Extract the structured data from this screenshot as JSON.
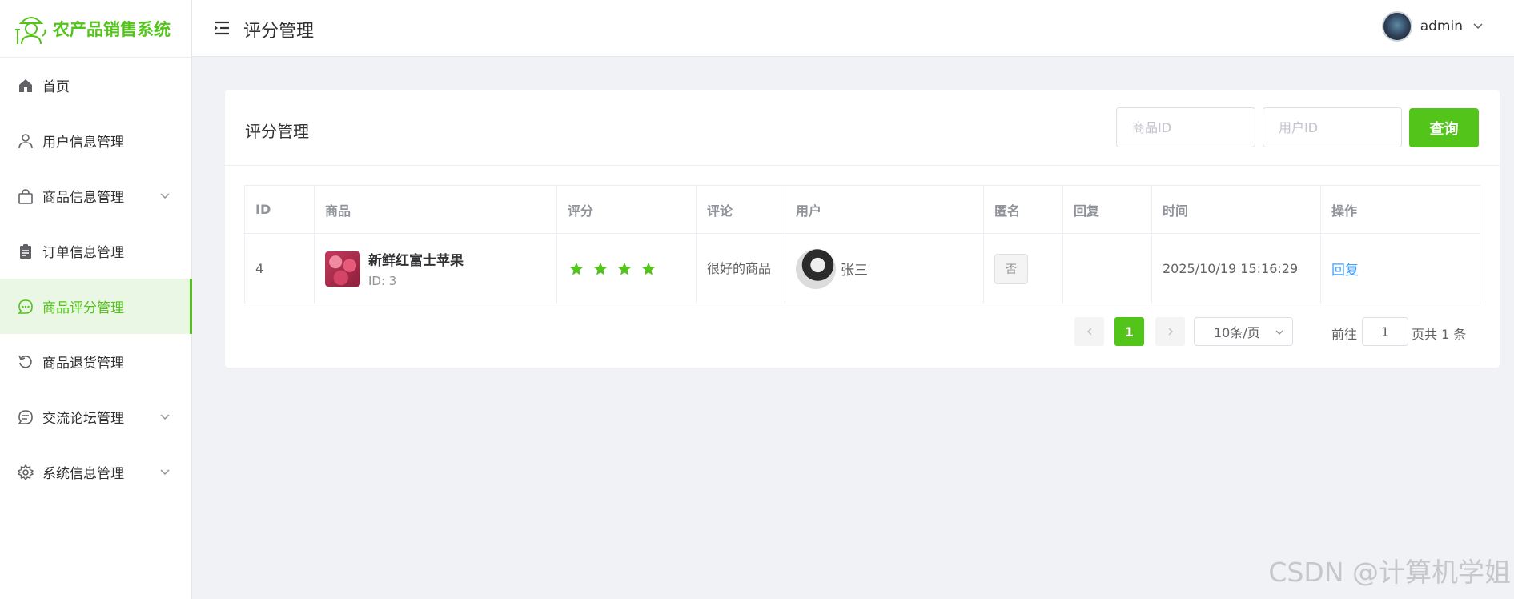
{
  "app": {
    "title": "农产品销售系统"
  },
  "sidebar": {
    "items": [
      {
        "label": "首页",
        "icon": "home-icon"
      },
      {
        "label": "用户信息管理",
        "icon": "user-icon"
      },
      {
        "label": "商品信息管理",
        "icon": "shopping-bag-icon",
        "expandable": true
      },
      {
        "label": "订单信息管理",
        "icon": "clipboard-icon"
      },
      {
        "label": "商品评分管理",
        "icon": "chat-dots-icon",
        "active": true
      },
      {
        "label": "商品退货管理",
        "icon": "refresh-icon"
      },
      {
        "label": "交流论坛管理",
        "icon": "message-icon",
        "expandable": true
      },
      {
        "label": "系统信息管理",
        "icon": "gear-icon",
        "expandable": true
      }
    ]
  },
  "header": {
    "title": "评分管理",
    "username": "admin"
  },
  "card": {
    "title": "评分管理",
    "search": {
      "product_id_placeholder": "商品ID",
      "user_id_placeholder": "用户ID",
      "button_label": "查询"
    }
  },
  "table": {
    "columns": [
      "ID",
      "商品",
      "评分",
      "评论",
      "用户",
      "匿名",
      "回复",
      "时间",
      "操作"
    ],
    "rows": [
      {
        "id": "4",
        "product_name": "新鲜红富士苹果",
        "product_id": "ID: 3",
        "rating": 4,
        "comment": "很好的商品",
        "user": "张三",
        "anonymous": "否",
        "reply": "",
        "time": "2025/10/19 15:16:29",
        "action": "回复"
      }
    ]
  },
  "pagination": {
    "current_page": "1",
    "page_size": "10条/页",
    "goto_label": "前往",
    "goto_value": "1",
    "total_label": "页共 1 条"
  },
  "watermark": "CSDN @计算机学姐",
  "colors": {
    "accent": "#52c41a",
    "link": "#409eff"
  }
}
